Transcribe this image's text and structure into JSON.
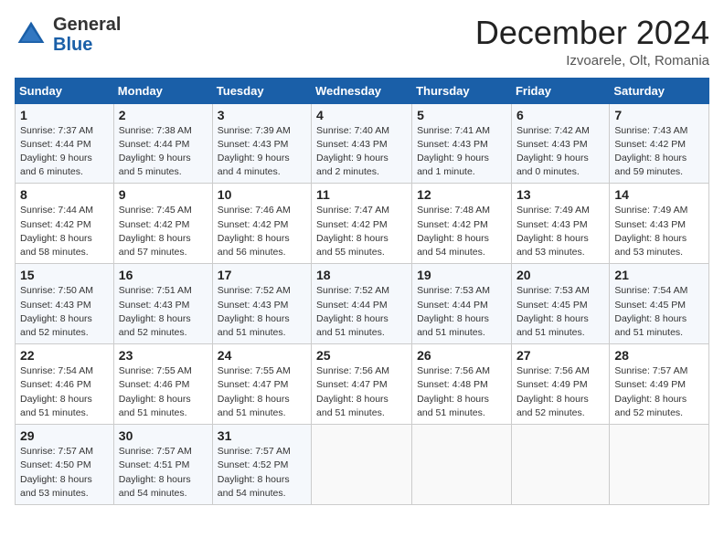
{
  "header": {
    "logo_general": "General",
    "logo_blue": "Blue",
    "month_title": "December 2024",
    "location": "Izvoarele, Olt, Romania"
  },
  "days_of_week": [
    "Sunday",
    "Monday",
    "Tuesday",
    "Wednesday",
    "Thursday",
    "Friday",
    "Saturday"
  ],
  "weeks": [
    [
      {
        "day": "1",
        "detail": "Sunrise: 7:37 AM\nSunset: 4:44 PM\nDaylight: 9 hours and 6 minutes."
      },
      {
        "day": "2",
        "detail": "Sunrise: 7:38 AM\nSunset: 4:44 PM\nDaylight: 9 hours and 5 minutes."
      },
      {
        "day": "3",
        "detail": "Sunrise: 7:39 AM\nSunset: 4:43 PM\nDaylight: 9 hours and 4 minutes."
      },
      {
        "day": "4",
        "detail": "Sunrise: 7:40 AM\nSunset: 4:43 PM\nDaylight: 9 hours and 2 minutes."
      },
      {
        "day": "5",
        "detail": "Sunrise: 7:41 AM\nSunset: 4:43 PM\nDaylight: 9 hours and 1 minute."
      },
      {
        "day": "6",
        "detail": "Sunrise: 7:42 AM\nSunset: 4:43 PM\nDaylight: 9 hours and 0 minutes."
      },
      {
        "day": "7",
        "detail": "Sunrise: 7:43 AM\nSunset: 4:42 PM\nDaylight: 8 hours and 59 minutes."
      }
    ],
    [
      {
        "day": "8",
        "detail": "Sunrise: 7:44 AM\nSunset: 4:42 PM\nDaylight: 8 hours and 58 minutes."
      },
      {
        "day": "9",
        "detail": "Sunrise: 7:45 AM\nSunset: 4:42 PM\nDaylight: 8 hours and 57 minutes."
      },
      {
        "day": "10",
        "detail": "Sunrise: 7:46 AM\nSunset: 4:42 PM\nDaylight: 8 hours and 56 minutes."
      },
      {
        "day": "11",
        "detail": "Sunrise: 7:47 AM\nSunset: 4:42 PM\nDaylight: 8 hours and 55 minutes."
      },
      {
        "day": "12",
        "detail": "Sunrise: 7:48 AM\nSunset: 4:42 PM\nDaylight: 8 hours and 54 minutes."
      },
      {
        "day": "13",
        "detail": "Sunrise: 7:49 AM\nSunset: 4:43 PM\nDaylight: 8 hours and 53 minutes."
      },
      {
        "day": "14",
        "detail": "Sunrise: 7:49 AM\nSunset: 4:43 PM\nDaylight: 8 hours and 53 minutes."
      }
    ],
    [
      {
        "day": "15",
        "detail": "Sunrise: 7:50 AM\nSunset: 4:43 PM\nDaylight: 8 hours and 52 minutes."
      },
      {
        "day": "16",
        "detail": "Sunrise: 7:51 AM\nSunset: 4:43 PM\nDaylight: 8 hours and 52 minutes."
      },
      {
        "day": "17",
        "detail": "Sunrise: 7:52 AM\nSunset: 4:43 PM\nDaylight: 8 hours and 51 minutes."
      },
      {
        "day": "18",
        "detail": "Sunrise: 7:52 AM\nSunset: 4:44 PM\nDaylight: 8 hours and 51 minutes."
      },
      {
        "day": "19",
        "detail": "Sunrise: 7:53 AM\nSunset: 4:44 PM\nDaylight: 8 hours and 51 minutes."
      },
      {
        "day": "20",
        "detail": "Sunrise: 7:53 AM\nSunset: 4:45 PM\nDaylight: 8 hours and 51 minutes."
      },
      {
        "day": "21",
        "detail": "Sunrise: 7:54 AM\nSunset: 4:45 PM\nDaylight: 8 hours and 51 minutes."
      }
    ],
    [
      {
        "day": "22",
        "detail": "Sunrise: 7:54 AM\nSunset: 4:46 PM\nDaylight: 8 hours and 51 minutes."
      },
      {
        "day": "23",
        "detail": "Sunrise: 7:55 AM\nSunset: 4:46 PM\nDaylight: 8 hours and 51 minutes."
      },
      {
        "day": "24",
        "detail": "Sunrise: 7:55 AM\nSunset: 4:47 PM\nDaylight: 8 hours and 51 minutes."
      },
      {
        "day": "25",
        "detail": "Sunrise: 7:56 AM\nSunset: 4:47 PM\nDaylight: 8 hours and 51 minutes."
      },
      {
        "day": "26",
        "detail": "Sunrise: 7:56 AM\nSunset: 4:48 PM\nDaylight: 8 hours and 51 minutes."
      },
      {
        "day": "27",
        "detail": "Sunrise: 7:56 AM\nSunset: 4:49 PM\nDaylight: 8 hours and 52 minutes."
      },
      {
        "day": "28",
        "detail": "Sunrise: 7:57 AM\nSunset: 4:49 PM\nDaylight: 8 hours and 52 minutes."
      }
    ],
    [
      {
        "day": "29",
        "detail": "Sunrise: 7:57 AM\nSunset: 4:50 PM\nDaylight: 8 hours and 53 minutes."
      },
      {
        "day": "30",
        "detail": "Sunrise: 7:57 AM\nSunset: 4:51 PM\nDaylight: 8 hours and 54 minutes."
      },
      {
        "day": "31",
        "detail": "Sunrise: 7:57 AM\nSunset: 4:52 PM\nDaylight: 8 hours and 54 minutes."
      },
      null,
      null,
      null,
      null
    ]
  ]
}
